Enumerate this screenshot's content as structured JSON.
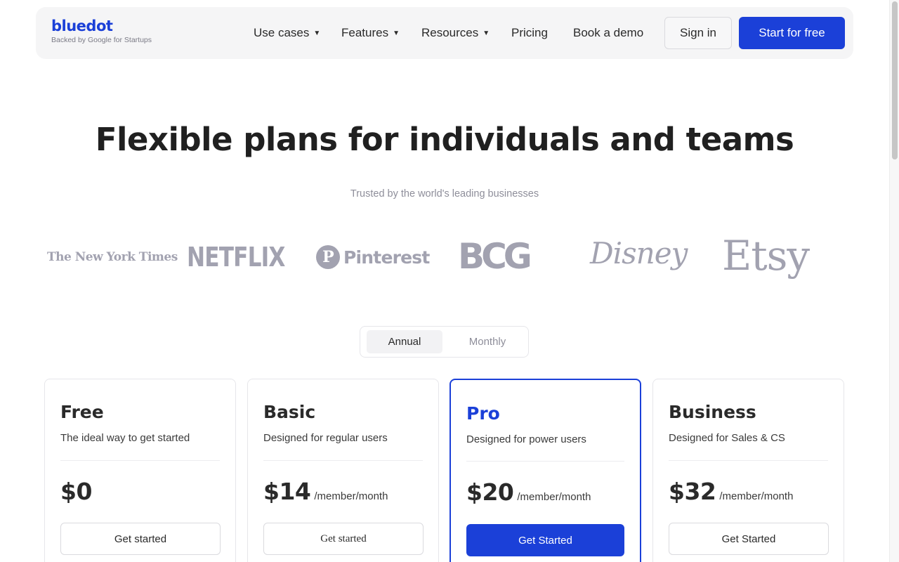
{
  "header": {
    "logo": {
      "word": "bluedot",
      "sub": "Backed by Google for Startups"
    },
    "nav": [
      {
        "label": "Use cases",
        "caret": "▼"
      },
      {
        "label": "Features",
        "caret": "▼"
      },
      {
        "label": "Resources",
        "caret": "▼"
      },
      {
        "label": "Pricing"
      },
      {
        "label": "Book a demo"
      }
    ],
    "signin_label": "Sign in",
    "start_label": "Start for free"
  },
  "hero": {
    "title": "Flexible plans for individuals and teams",
    "trusted": "Trusted by the world's leading businesses"
  },
  "logos": {
    "nyt": "The New York Times",
    "netflix": "NETFLIX",
    "pinterest": "Pinterest",
    "pinterest_mark": "P",
    "bcg": "BCG",
    "disney": "Disney",
    "etsy": "Etsy"
  },
  "billing_toggle": {
    "annual": "Annual",
    "monthly": "Monthly",
    "selected": "Annual"
  },
  "plans": [
    {
      "name": "Free",
      "desc": "The ideal way to get started",
      "price": "$0",
      "per": "",
      "cta": "Get started"
    },
    {
      "name": "Basic",
      "desc": "Designed for regular users",
      "price": "$14",
      "per": "/member/month",
      "cta": "Get started"
    },
    {
      "name": "Pro",
      "desc": "Designed for power users",
      "price": "$20",
      "per": "/member/month",
      "cta": "Get Started"
    },
    {
      "name": "Business",
      "desc": "Designed for Sales & CS",
      "price": "$32",
      "per": "/member/month",
      "cta": "Get Started"
    }
  ],
  "colors": {
    "brand": "#1b40d8",
    "logo_gray": "#a2a2b0",
    "header_bg": "#f5f5f6"
  }
}
